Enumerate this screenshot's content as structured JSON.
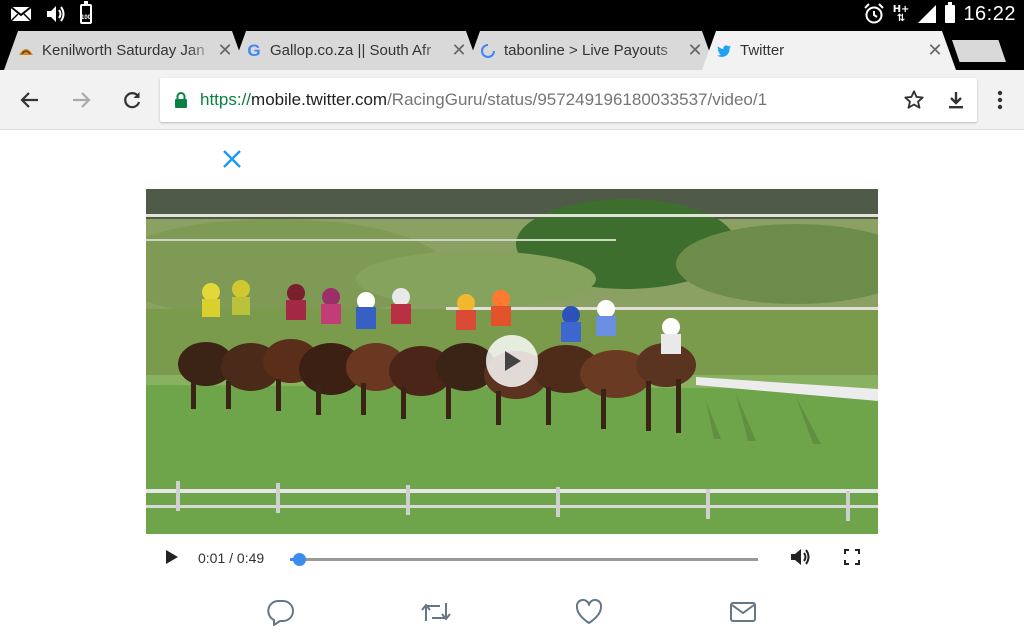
{
  "status_bar": {
    "time": "16:22",
    "battery_level": "100",
    "network": "H+",
    "icons": [
      "mail-icon",
      "volume-icon",
      "battery-icon",
      "alarm-icon",
      "network-icon",
      "signal-icon",
      "battery-full-icon"
    ]
  },
  "tabs": [
    {
      "title": "Kenilworth Saturday Jan",
      "favicon": "racing-favicon",
      "active": false
    },
    {
      "title": "Gallop.co.za || South Afr",
      "favicon": "google-favicon",
      "active": false
    },
    {
      "title": "tabonline > Live Payouts",
      "favicon": "loading-favicon",
      "active": false
    },
    {
      "title": "Twitter",
      "favicon": "twitter-favicon",
      "active": true
    }
  ],
  "toolbar": {
    "url_scheme": "https://",
    "url_host": "mobile.twitter.com",
    "url_path": "/RacingGuru/status/957249196180033537/video/1"
  },
  "video": {
    "current_time": "0:01",
    "separator": "/",
    "duration": "0:49",
    "progress_fraction": 0.02
  },
  "colors": {
    "accent_blue": "#3b8ced",
    "close_blue": "#1d9bf0",
    "secure_green": "#0b8043",
    "tab_inactive": "#d9d9d9",
    "tab_active": "#f2f2f2",
    "action_icon": "#657786"
  },
  "actions": [
    "reply-icon",
    "retweet-icon",
    "like-icon",
    "message-icon"
  ]
}
